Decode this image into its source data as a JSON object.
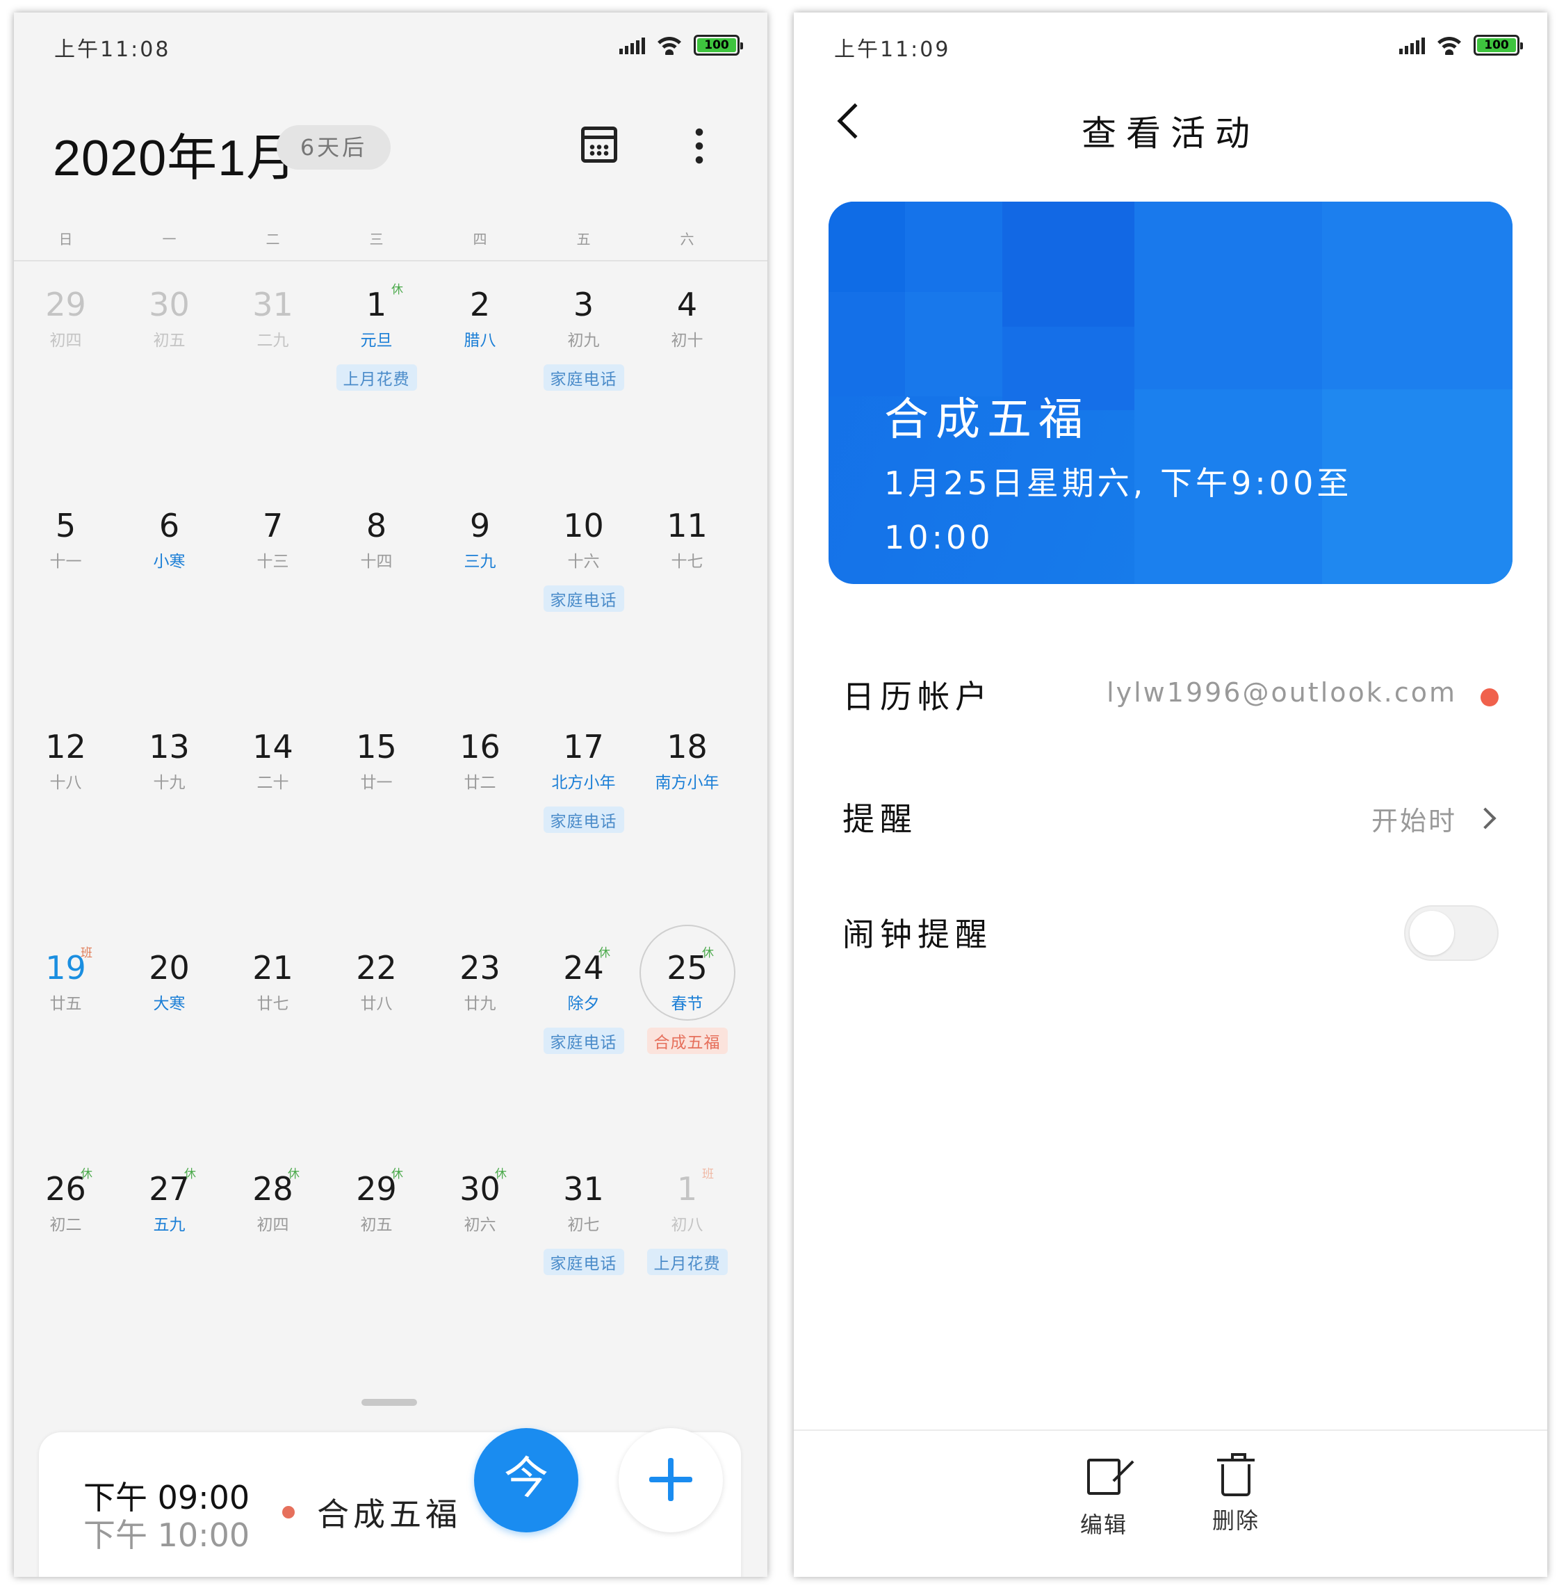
{
  "left": {
    "status": {
      "time": "上午11:08",
      "battery": "100"
    },
    "header": {
      "month_title": "2020年1月",
      "countdown": "6天后"
    },
    "weekdays": [
      "日",
      "一",
      "二",
      "三",
      "四",
      "五",
      "六"
    ],
    "weeks": [
      [
        {
          "day": "29",
          "lunar": "初四",
          "dim": true
        },
        {
          "day": "30",
          "lunar": "初五",
          "dim": true
        },
        {
          "day": "31",
          "lunar": "二九",
          "dim": true
        },
        {
          "day": "1",
          "lunar": "元旦",
          "lunar_blue": true,
          "mark": "休",
          "event": "上月花费"
        },
        {
          "day": "2",
          "lunar": "腊八",
          "lunar_blue": true
        },
        {
          "day": "3",
          "lunar": "初九",
          "event": "家庭电话"
        },
        {
          "day": "4",
          "lunar": "初十"
        }
      ],
      [
        {
          "day": "5",
          "lunar": "十一"
        },
        {
          "day": "6",
          "lunar": "小寒",
          "lunar_blue": true
        },
        {
          "day": "7",
          "lunar": "十三"
        },
        {
          "day": "8",
          "lunar": "十四"
        },
        {
          "day": "9",
          "lunar": "三九",
          "lunar_blue": true
        },
        {
          "day": "10",
          "lunar": "十六",
          "event": "家庭电话"
        },
        {
          "day": "11",
          "lunar": "十七"
        }
      ],
      [
        {
          "day": "12",
          "lunar": "十八"
        },
        {
          "day": "13",
          "lunar": "十九"
        },
        {
          "day": "14",
          "lunar": "二十"
        },
        {
          "day": "15",
          "lunar": "廿一"
        },
        {
          "day": "16",
          "lunar": "廿二"
        },
        {
          "day": "17",
          "lunar": "北方小年",
          "lunar_blue": true,
          "event": "家庭电话"
        },
        {
          "day": "18",
          "lunar": "南方小年",
          "lunar_blue": true
        }
      ],
      [
        {
          "day": "19",
          "lunar": "廿五",
          "num_blue": true,
          "mark": "班",
          "mark_type": "ban"
        },
        {
          "day": "20",
          "lunar": "大寒",
          "lunar_blue": true
        },
        {
          "day": "21",
          "lunar": "廿七"
        },
        {
          "day": "22",
          "lunar": "廿八"
        },
        {
          "day": "23",
          "lunar": "廿九"
        },
        {
          "day": "24",
          "lunar": "除夕",
          "lunar_blue": true,
          "mark": "休",
          "event": "家庭电话"
        },
        {
          "day": "25",
          "lunar": "春节",
          "lunar_blue": true,
          "mark": "休",
          "event": "合成五福",
          "event_red": true,
          "today": true
        }
      ],
      [
        {
          "day": "26",
          "lunar": "初二",
          "mark": "休"
        },
        {
          "day": "27",
          "lunar": "五九",
          "lunar_blue": true,
          "mark": "休"
        },
        {
          "day": "28",
          "lunar": "初四",
          "mark": "休"
        },
        {
          "day": "29",
          "lunar": "初五",
          "mark": "休"
        },
        {
          "day": "30",
          "lunar": "初六",
          "mark": "休"
        },
        {
          "day": "31",
          "lunar": "初七",
          "event": "家庭电话"
        },
        {
          "day": "1",
          "lunar": "初八",
          "dim": true,
          "mark": "班",
          "mark_type": "ban",
          "event": "上月花费"
        }
      ]
    ],
    "agenda": {
      "start": "下午 09:00",
      "end": "下午 10:00",
      "title": "合成五福",
      "dot_color": "#e6705c"
    },
    "fab_today": "今",
    "fab_add_icon": "plus-icon",
    "accent": "#1a8cf0"
  },
  "right": {
    "status": {
      "time": "上午11:09",
      "battery": "100"
    },
    "title": "查看活动",
    "event": {
      "name": "合成五福",
      "time": "1月25日星期六, 下午9:00至10:00",
      "card_color": "#1679ea"
    },
    "fields": {
      "account_label": "日历帐户",
      "account_value": "lylw1996@outlook.com",
      "account_color": "#f0614c",
      "reminder_label": "提醒",
      "reminder_value": "开始时",
      "alarm_label": "闹钟提醒",
      "alarm_on": false
    },
    "actions": {
      "edit": "编辑",
      "delete": "删除"
    }
  }
}
